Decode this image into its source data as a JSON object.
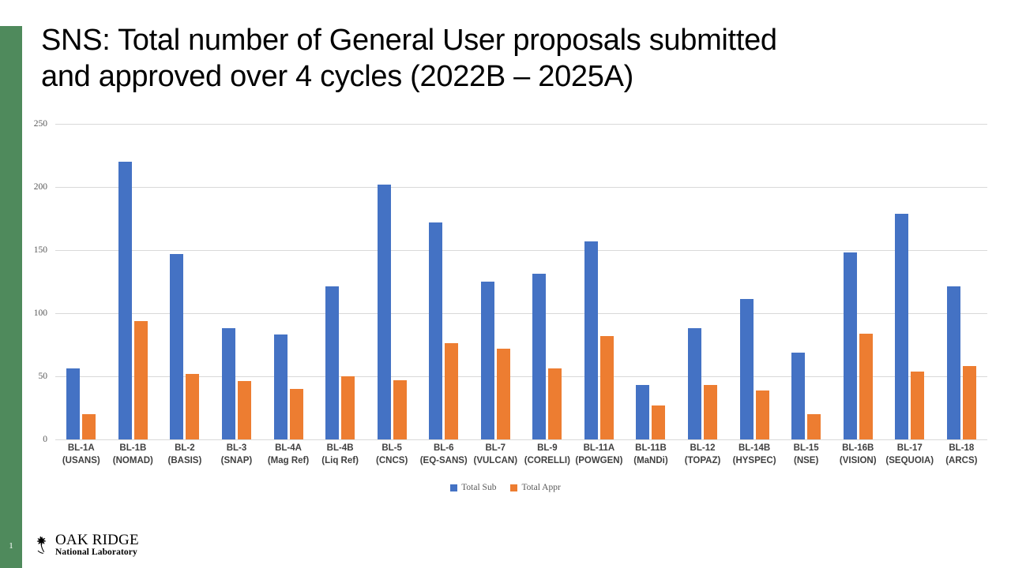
{
  "slide": {
    "number": "1",
    "title": "SNS: Total number of General User proposals submitted\nand approved over 4 cycles (2022B – 2025A)",
    "accent_color": "#4F8A5C"
  },
  "logo": {
    "line1_a": "O",
    "line1_b": "AK ",
    "line1_c": "R",
    "line1_d": "IDGE",
    "line1": "OAK RIDGE",
    "line2": "National Laboratory"
  },
  "chart_data": {
    "type": "bar",
    "title": "SNS: Total number of General User proposals submitted and approved over 4 cycles (2022B – 2025A)",
    "xlabel": "",
    "ylabel": "",
    "ylim": [
      0,
      250
    ],
    "yticks": [
      0,
      50,
      100,
      150,
      200,
      250
    ],
    "ytick_labels": [
      "0",
      "50",
      "100",
      "150",
      "200",
      "250"
    ],
    "grid": true,
    "legend_position": "bottom",
    "colors": {
      "Total Sub": "#4472C4",
      "Total Appr": "#ED7D31"
    },
    "categories": [
      "BL-1A\n(USANS)",
      "BL-1B\n(NOMAD)",
      "BL-2\n(BASIS)",
      "BL-3\n(SNAP)",
      "BL-4A\n(Mag Ref)",
      "BL-4B\n(Liq Ref)",
      "BL-5\n(CNCS)",
      "BL-6\n(EQ-SANS)",
      "BL-7\n(VULCAN)",
      "BL-9\n(CORELLI)",
      "BL-11A\n(POWGEN)",
      "BL-11B\n(MaNDi)",
      "BL-12\n(TOPAZ)",
      "BL-14B\n(HYSPEC)",
      "BL-15\n(NSE)",
      "BL-16B\n(VISION)",
      "BL-17\n(SEQUOIA)",
      "BL-18\n(ARCS)"
    ],
    "series": [
      {
        "name": "Total Sub",
        "color": "#4472C4",
        "values": [
          56,
          220,
          147,
          88,
          83,
          121,
          202,
          172,
          125,
          131,
          157,
          43,
          88,
          111,
          69,
          148,
          179,
          121
        ]
      },
      {
        "name": "Total Appr",
        "color": "#ED7D31",
        "values": [
          20,
          94,
          52,
          46,
          40,
          50,
          47,
          76,
          72,
          56,
          82,
          27,
          43,
          39,
          20,
          84,
          54,
          58
        ]
      }
    ]
  }
}
